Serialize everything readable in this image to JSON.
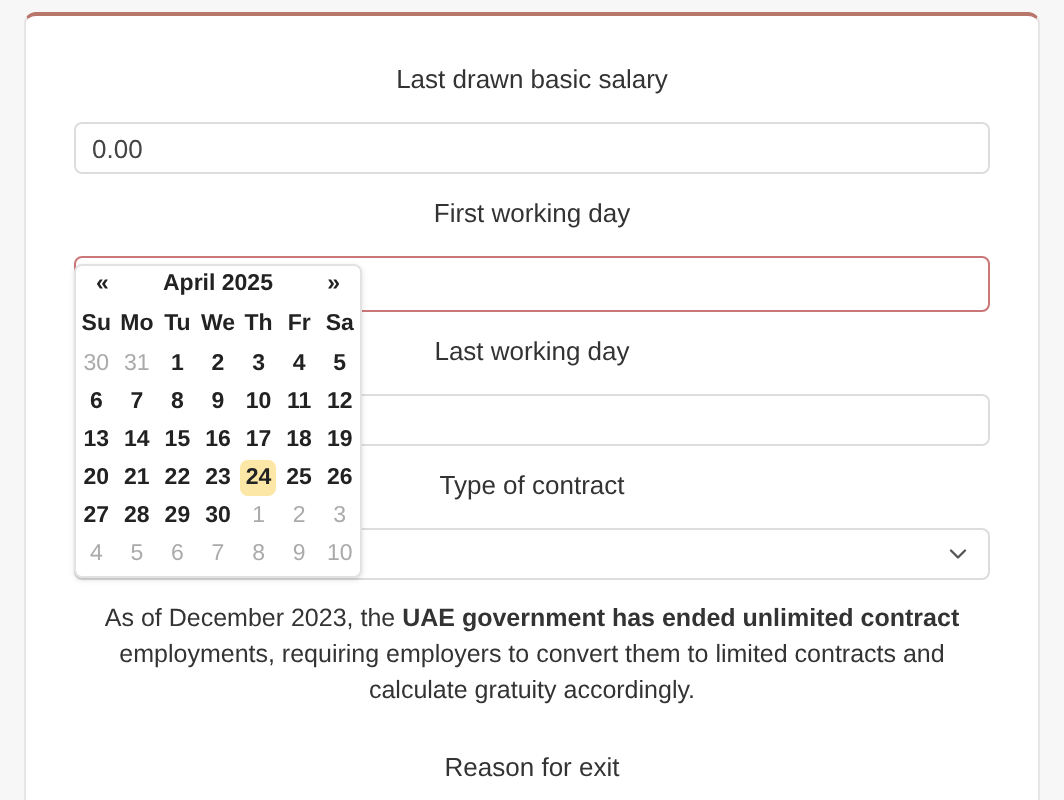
{
  "fields": [
    {
      "kind": "text",
      "label": "Last drawn basic salary",
      "value": "0.00"
    },
    {
      "kind": "date",
      "label": "First working day",
      "focused": true
    },
    {
      "kind": "date",
      "label": "Last working day"
    },
    {
      "kind": "select",
      "label": "Type of contract"
    }
  ],
  "calendar": {
    "prev": "«",
    "title": "April 2025",
    "next": "»",
    "weekdays": [
      "Su",
      "Mo",
      "Tu",
      "We",
      "Th",
      "Fr",
      "Sa"
    ],
    "weeks": [
      [
        {
          "day": "30",
          "muted": true,
          "selected": false
        },
        {
          "day": "31",
          "muted": true,
          "selected": false
        },
        {
          "day": "1",
          "muted": false,
          "selected": false
        },
        {
          "day": "2",
          "muted": false,
          "selected": false
        },
        {
          "day": "3",
          "muted": false,
          "selected": false
        },
        {
          "day": "4",
          "muted": false,
          "selected": false
        },
        {
          "day": "5",
          "muted": false,
          "selected": false
        }
      ],
      [
        {
          "day": "6",
          "muted": false,
          "selected": false
        },
        {
          "day": "7",
          "muted": false,
          "selected": false
        },
        {
          "day": "8",
          "muted": false,
          "selected": false
        },
        {
          "day": "9",
          "muted": false,
          "selected": false
        },
        {
          "day": "10",
          "muted": false,
          "selected": false
        },
        {
          "day": "11",
          "muted": false,
          "selected": false
        },
        {
          "day": "12",
          "muted": false,
          "selected": false
        }
      ],
      [
        {
          "day": "13",
          "muted": false,
          "selected": false
        },
        {
          "day": "14",
          "muted": false,
          "selected": false
        },
        {
          "day": "15",
          "muted": false,
          "selected": false
        },
        {
          "day": "16",
          "muted": false,
          "selected": false
        },
        {
          "day": "17",
          "muted": false,
          "selected": false
        },
        {
          "day": "18",
          "muted": false,
          "selected": false
        },
        {
          "day": "19",
          "muted": false,
          "selected": false
        }
      ],
      [
        {
          "day": "20",
          "muted": false,
          "selected": false
        },
        {
          "day": "21",
          "muted": false,
          "selected": false
        },
        {
          "day": "22",
          "muted": false,
          "selected": false
        },
        {
          "day": "23",
          "muted": false,
          "selected": false
        },
        {
          "day": "24",
          "muted": false,
          "selected": true
        },
        {
          "day": "25",
          "muted": false,
          "selected": false
        },
        {
          "day": "26",
          "muted": false,
          "selected": false
        }
      ],
      [
        {
          "day": "27",
          "muted": false,
          "selected": false
        },
        {
          "day": "28",
          "muted": false,
          "selected": false
        },
        {
          "day": "29",
          "muted": false,
          "selected": false
        },
        {
          "day": "30",
          "muted": false,
          "selected": false
        },
        {
          "day": "1",
          "muted": true,
          "selected": false
        },
        {
          "day": "2",
          "muted": true,
          "selected": false
        },
        {
          "day": "3",
          "muted": true,
          "selected": false
        }
      ],
      [
        {
          "day": "4",
          "muted": true,
          "selected": false
        },
        {
          "day": "5",
          "muted": true,
          "selected": false
        },
        {
          "day": "6",
          "muted": true,
          "selected": false
        },
        {
          "day": "7",
          "muted": true,
          "selected": false
        },
        {
          "day": "8",
          "muted": true,
          "selected": false
        },
        {
          "day": "9",
          "muted": true,
          "selected": false
        },
        {
          "day": "10",
          "muted": true,
          "selected": false
        }
      ]
    ]
  },
  "notice": "As of December 2023, the **UAE government has ended unlimited contract** employments, requiring employers to convert them to limited contracts and calculate gratuity accordingly.",
  "next_label": "Reason for exit"
}
